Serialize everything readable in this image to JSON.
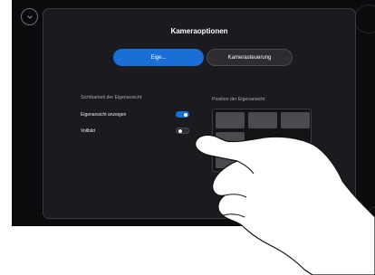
{
  "dialog": {
    "title": "Kameraoptionen",
    "tabs": [
      {
        "label": "Eige...",
        "selected": true
      },
      {
        "label": "Kamerasteuerung",
        "selected": false
      }
    ]
  },
  "self_view": {
    "section_label": "Sichtbarkeit der Eigenansicht",
    "rows": [
      {
        "label": "Eigenansicht anzeigen",
        "toggle_on": true
      },
      {
        "label": "Vollbild",
        "toggle_on": false
      }
    ]
  },
  "position": {
    "section_label": "Position der Eigenansicht",
    "selected_cell": "middle-right"
  },
  "colors": {
    "accent": "#1a6fd6",
    "panel": "#1b1b1f",
    "background": "#0b0b0d"
  },
  "icons": [
    "close-icon",
    "self-view-camera-icon"
  ]
}
